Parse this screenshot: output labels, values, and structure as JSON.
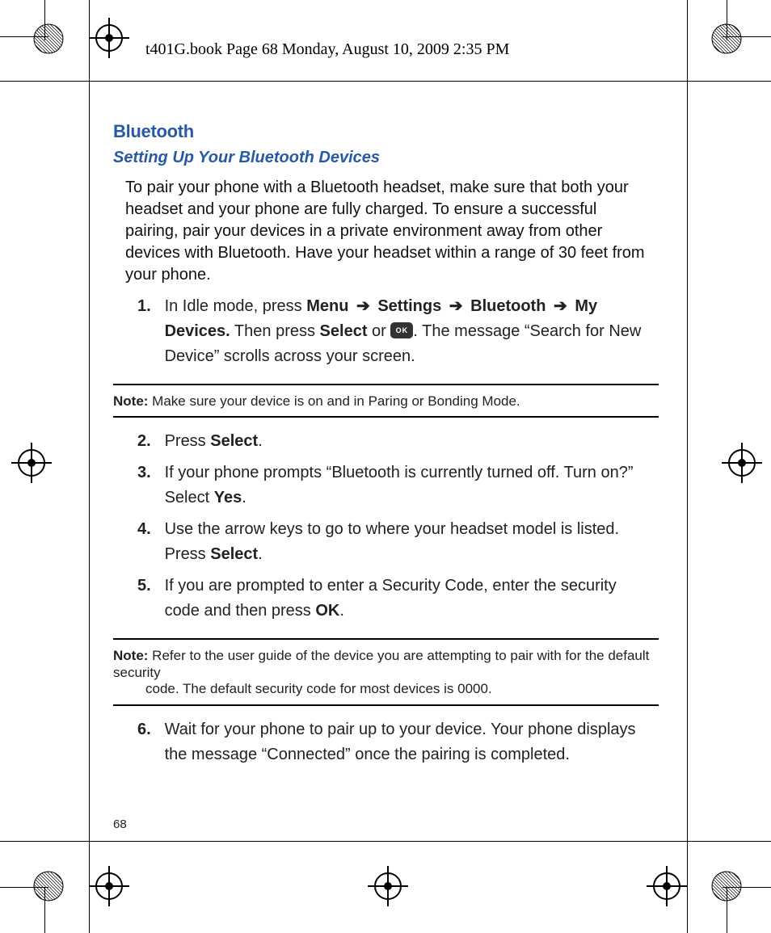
{
  "header": "t401G.book  Page 68  Monday, August 10, 2009  2:35 PM",
  "h1": "Bluetooth",
  "h2": "Setting Up Your Bluetooth Devices",
  "intro": "To pair your phone with a Bluetooth headset, make sure that both your headset and your phone are fully charged. To ensure a successful pairing, pair your devices in a private environment away from other devices with Bluetooth. Have your headset within a range of 30 feet from your phone.",
  "steps": {
    "s1": {
      "num": "1.",
      "pre": "In Idle mode, press ",
      "menu": "Menu",
      "arrow": "➔",
      "settings": "Settings",
      "bt": "Bluetooth",
      "mydev": "My Devices.",
      "thenpress": " Then press ",
      "select": "Select",
      "or": " or ",
      "ok": "OK",
      "post": ". The message “Search for New Device” scrolls across your screen."
    },
    "s2": {
      "num": "2.",
      "press": "Press ",
      "select": "Select",
      "dot": "."
    },
    "s3": {
      "num": "3.",
      "line1": "If your phone prompts “Bluetooth is currently turned off. Turn on?”",
      "line2a": "Select ",
      "yes": "Yes",
      "dot": "."
    },
    "s4": {
      "num": "4.",
      "a": "Use the arrow keys to go to where your headset model is listed. Press ",
      "select": "Select",
      "dot": "."
    },
    "s5": {
      "num": "5.",
      "a": "If you are prompted to enter a Security Code, enter the security code and then press ",
      "ok": "OK",
      "dot": "."
    },
    "s6": {
      "num": "6.",
      "a": "Wait for your phone to pair up to your device. Your phone displays the message “Connected” once the pairing is completed."
    }
  },
  "note1": {
    "label": "Note:",
    "body": " Make sure your device is on and in Paring or Bonding Mode."
  },
  "note2": {
    "label": "Note:",
    "body": " Refer to the user guide of the device you are attempting to pair with for the default security",
    "body2": "code. The default security code for most devices is 0000."
  },
  "page": "68"
}
